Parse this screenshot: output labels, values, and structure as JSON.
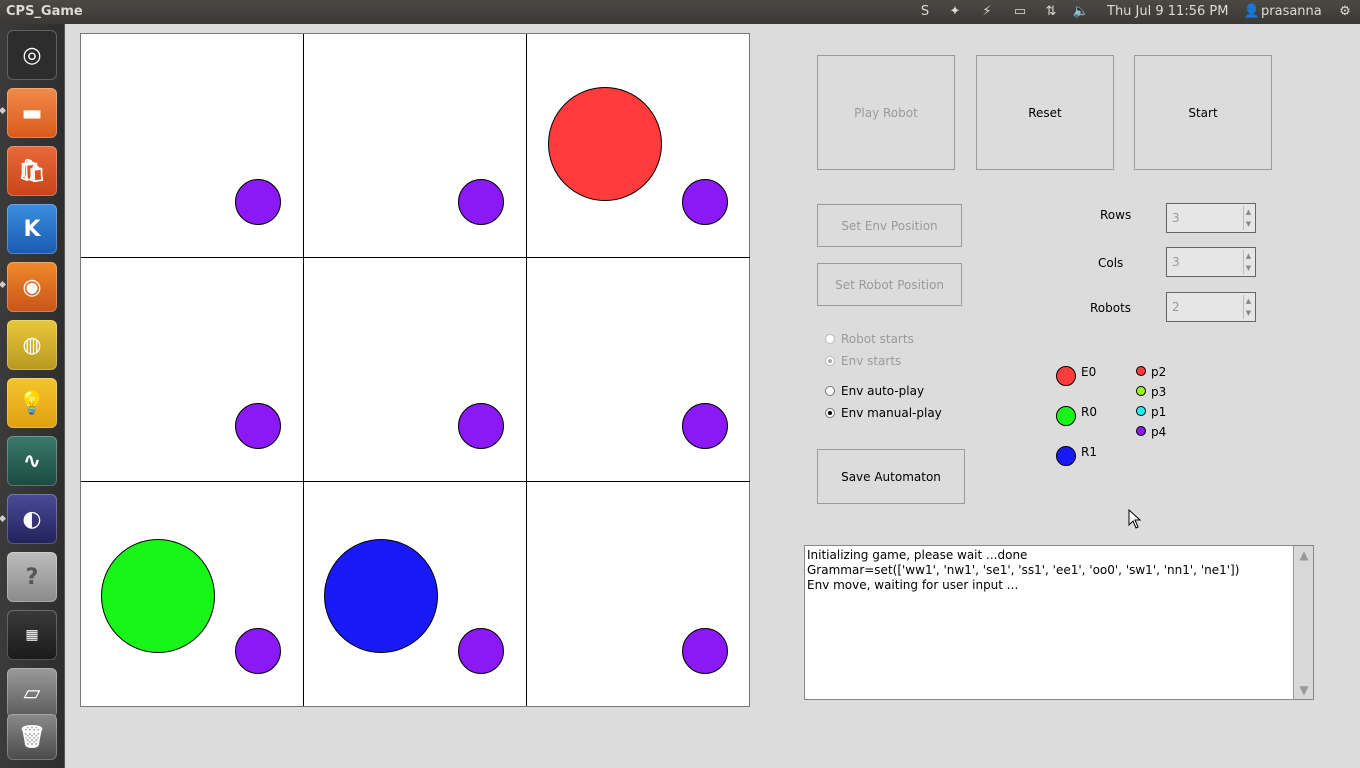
{
  "window": {
    "title": "CPS_Game"
  },
  "panel": {
    "clock": "Thu Jul  9 11:56 PM",
    "user": "prasanna",
    "icons": [
      "skype-icon",
      "dropbox-icon",
      "network-icon",
      "battery-icon",
      "transfer-icon",
      "volume-icon"
    ]
  },
  "launcher": [
    "ubuntu-logo-icon",
    "files-folder-icon",
    "software-center-icon",
    "kile-icon",
    "firefox-icon",
    "chrome-icon",
    "ideas-bulb-icon",
    "system-monitor-icon",
    "eclipse-icon",
    "help-icon",
    "workspace-switcher-icon",
    "drive-icon",
    "trash-icon"
  ],
  "board": {
    "rows": 3,
    "cols": 3,
    "cells": [
      {
        "big": null,
        "small": "#8a19f5"
      },
      {
        "big": null,
        "small": "#8a19f5"
      },
      {
        "big": "#ff3b3b",
        "small": "#8a19f5"
      },
      {
        "big": null,
        "small": "#8a19f5"
      },
      {
        "big": null,
        "small": "#8a19f5"
      },
      {
        "big": null,
        "small": "#8a19f5"
      },
      {
        "big": "#19f519",
        "small": "#8a19f5"
      },
      {
        "big": "#1919f5",
        "small": "#8a19f5"
      },
      {
        "big": null,
        "small": "#8a19f5"
      }
    ]
  },
  "buttons": {
    "play_robot": "Play Robot",
    "reset": "Reset",
    "start": "Start",
    "set_env": "Set Env Position",
    "set_robot": "Set Robot Position",
    "save": "Save Automaton"
  },
  "settings": {
    "rows_label": "Rows",
    "rows_value": "3",
    "cols_label": "Cols",
    "cols_value": "3",
    "robots_label": "Robots",
    "robots_value": "2"
  },
  "radios": {
    "robot_starts": "Robot starts",
    "env_starts": "Env starts",
    "env_auto": "Env auto-play",
    "env_manual": "Env manual-play"
  },
  "legend": {
    "agents": [
      {
        "label": "E0",
        "color": "#ff3b3b"
      },
      {
        "label": "R0",
        "color": "#19f519"
      },
      {
        "label": "R1",
        "color": "#1919f5"
      }
    ],
    "props": [
      {
        "label": "p2",
        "color": "#ff3b3b"
      },
      {
        "label": "p3",
        "color": "#9cf519"
      },
      {
        "label": "p1",
        "color": "#19f5f5"
      },
      {
        "label": "p4",
        "color": "#8a19f5"
      }
    ]
  },
  "log": {
    "line1": "Initializing game, please wait ...done",
    "line2": "Grammar=set(['ww1', 'nw1', 'se1', 'ss1', 'ee1', 'oo0', 'sw1', 'nn1', 'ne1'])",
    "line3": "Env move, waiting for user input ..."
  }
}
